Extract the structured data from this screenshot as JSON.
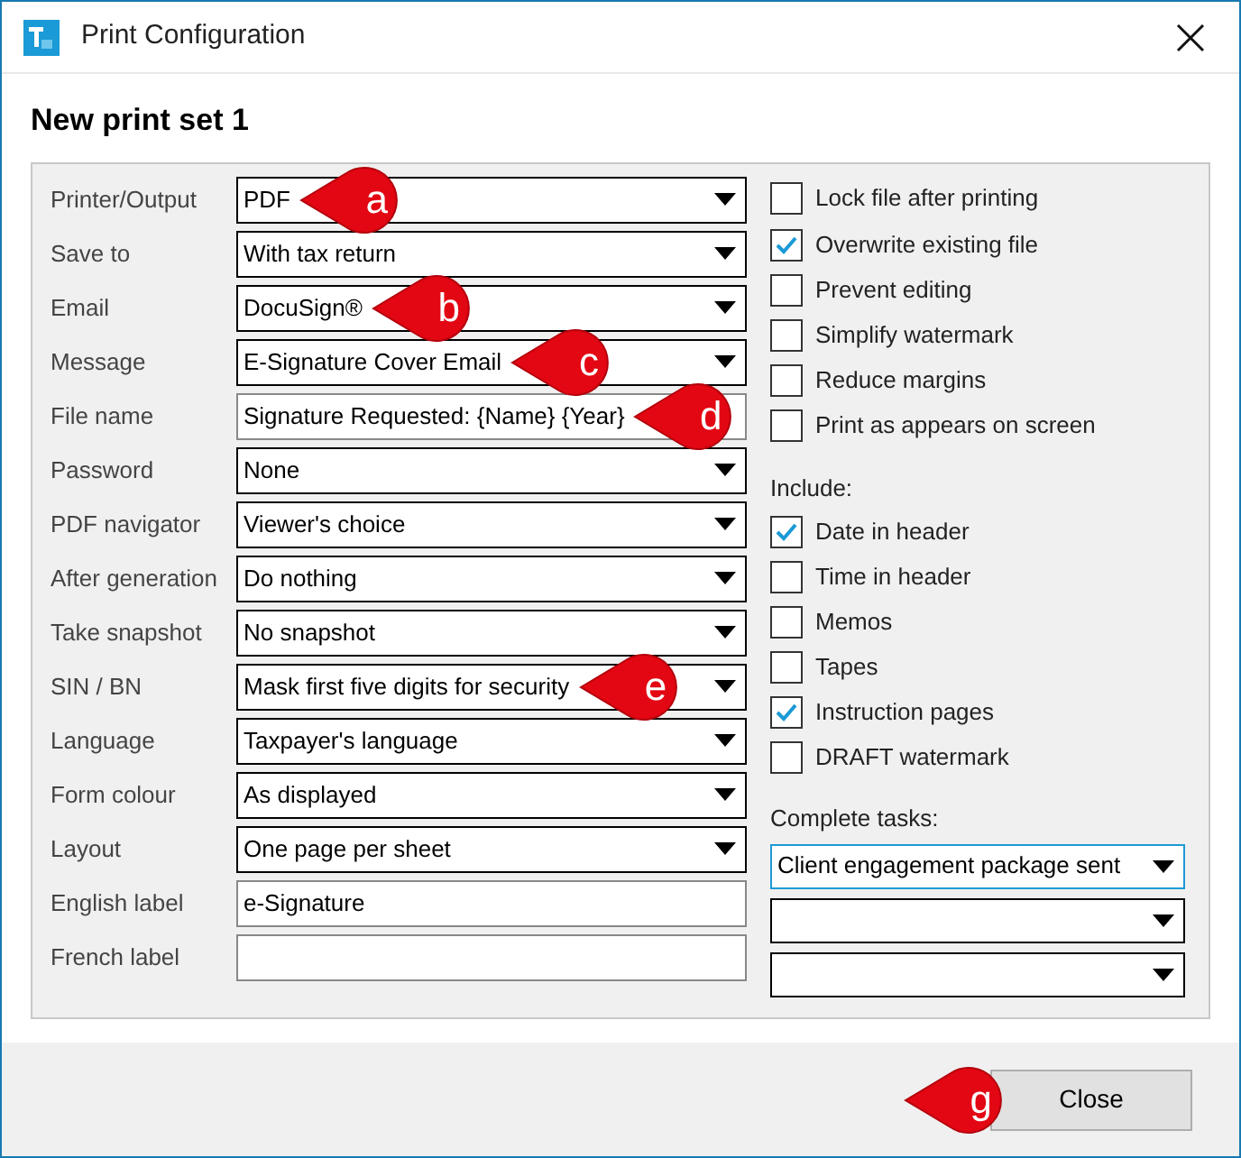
{
  "window": {
    "title": "Print Configuration"
  },
  "heading": "New print set 1",
  "fields": [
    {
      "label": "Printer/Output",
      "kind": "dropdown",
      "value": "PDF",
      "callout": "a"
    },
    {
      "label": "Save to",
      "kind": "dropdown",
      "value": "With tax return"
    },
    {
      "label": "Email",
      "kind": "dropdown",
      "value": "DocuSign®",
      "callout": "b"
    },
    {
      "label": "Message",
      "kind": "dropdown",
      "value": "E-Signature Cover Email",
      "callout": "c"
    },
    {
      "label": "File name",
      "kind": "text",
      "value": "Signature Requested: {Name} {Year}",
      "callout": "d"
    },
    {
      "label": "Password",
      "kind": "dropdown",
      "value": "None"
    },
    {
      "label": "PDF navigator",
      "kind": "dropdown",
      "value": "Viewer's choice"
    },
    {
      "label": "After generation",
      "kind": "dropdown",
      "value": "Do nothing"
    },
    {
      "label": "Take snapshot",
      "kind": "dropdown",
      "value": "No snapshot"
    },
    {
      "label": "SIN / BN",
      "kind": "dropdown",
      "value": "Mask first five digits for security",
      "callout": "e"
    },
    {
      "label": "Language",
      "kind": "dropdown",
      "value": "Taxpayer's language"
    },
    {
      "label": "Form colour",
      "kind": "dropdown",
      "value": "As displayed"
    },
    {
      "label": "Layout",
      "kind": "dropdown",
      "value": "One page per sheet"
    },
    {
      "label": "English label",
      "kind": "text",
      "value": "e-Signature"
    },
    {
      "label": "French label",
      "kind": "text"
    }
  ],
  "options": [
    {
      "label": "Lock file after printing",
      "checked": false
    },
    {
      "label": "Overwrite existing file",
      "checked": true
    },
    {
      "label": "Prevent editing",
      "checked": false
    },
    {
      "label": "Simplify watermark",
      "checked": false
    },
    {
      "label": "Reduce margins",
      "checked": false
    },
    {
      "label": "Print as appears on screen",
      "checked": false
    }
  ],
  "include": {
    "title": "Include:",
    "items": [
      {
        "label": "Date in header",
        "checked": true
      },
      {
        "label": "Time in header",
        "checked": false
      },
      {
        "label": "Memos",
        "checked": false
      },
      {
        "label": "Tapes",
        "checked": false
      },
      {
        "label": "Instruction pages",
        "checked": true
      },
      {
        "label": "DRAFT watermark",
        "checked": false
      }
    ]
  },
  "complete_tasks": {
    "title": "Complete tasks:",
    "dropdowns": [
      {
        "value": "Client engagement package sent",
        "focused": true
      },
      {
        "focused": false
      },
      {
        "focused": false
      }
    ]
  },
  "close_button": {
    "label": "Close",
    "callout": "g"
  }
}
